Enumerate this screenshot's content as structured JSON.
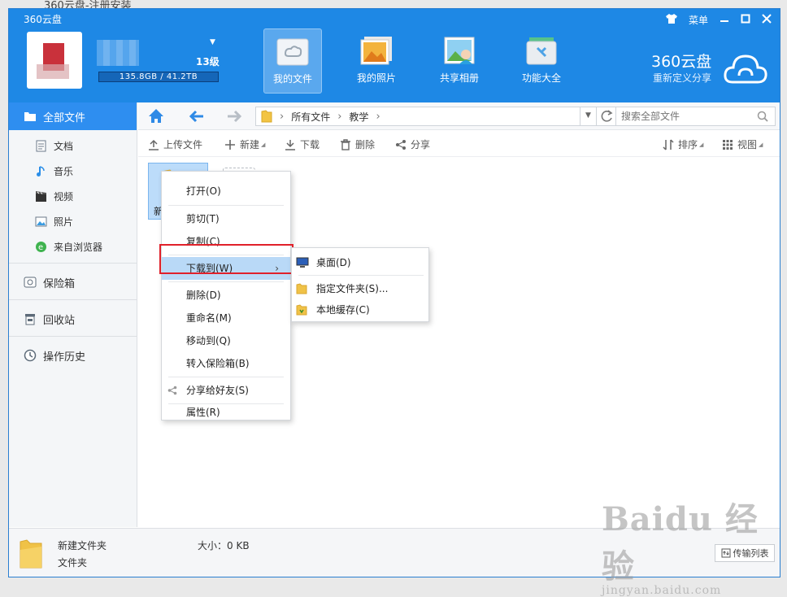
{
  "background_window": {
    "title": "360云盘-注册安装"
  },
  "app": {
    "title": "360云盘",
    "menu_label": "菜单"
  },
  "user": {
    "level": "13级",
    "quota": "135.8GB / 41.2TB"
  },
  "nav": [
    {
      "label": "我的文件",
      "active": true
    },
    {
      "label": "我的照片",
      "active": false
    },
    {
      "label": "共享相册",
      "active": false
    },
    {
      "label": "功能大全",
      "active": false
    }
  ],
  "brand": {
    "name": "360云盘",
    "slogan": "重新定义分享"
  },
  "sidebar": {
    "main": "全部文件",
    "sub": [
      "文档",
      "音乐",
      "视频",
      "照片",
      "来自浏览器"
    ],
    "safe": "保险箱",
    "recycle": "回收站",
    "history": "操作历史"
  },
  "path": {
    "items": [
      "所有文件",
      "教学"
    ]
  },
  "search": {
    "placeholder": "搜索全部文件"
  },
  "toolbar": {
    "upload": "上传文件",
    "new": "新建",
    "download": "下载",
    "delete": "删除",
    "share": "分享",
    "sort": "排序",
    "view": "视图"
  },
  "content": {
    "folder_label": "新建"
  },
  "context_menu": {
    "open": "打开(O)",
    "cut": "剪切(T)",
    "copy": "复制(C)",
    "download_to": "下载到(W)",
    "delete": "删除(D)",
    "rename": "重命名(M)",
    "move_to": "移动到(Q)",
    "to_safe": "转入保险箱(B)",
    "share_friend": "分享给好友(S)",
    "properties": "属性(R)"
  },
  "submenu": {
    "desktop": "桌面(D)",
    "folder": "指定文件夹(S)...",
    "cache": "本地缓存(C)"
  },
  "status": {
    "name": "新建文件夹",
    "type": "文件夹",
    "size": "大小：0 KB",
    "transfer": "传输列表"
  },
  "watermark": {
    "main": "Baidu 经验",
    "sub": "jingyan.baidu.com"
  },
  "colors": {
    "header": "#1e88e5",
    "accent": "#2e8ef0",
    "highlight": "#b9d9f7",
    "red_box": "#e0202a"
  }
}
